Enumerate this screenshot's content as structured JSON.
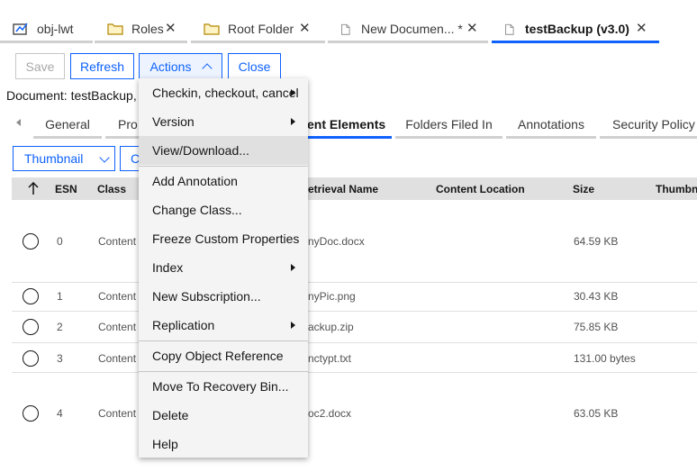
{
  "top_tabs": [
    {
      "label": "obj-lwt",
      "icon": "object-icon",
      "closable": false
    },
    {
      "label": "Roles",
      "icon": "folder-icon",
      "closable": true
    },
    {
      "label": "Root Folder",
      "icon": "folder-icon",
      "closable": true
    },
    {
      "label": "New Documen... *",
      "icon": "document-icon",
      "closable": true
    },
    {
      "label": "testBackup (v3.0)",
      "icon": "document-icon",
      "closable": true,
      "active": true
    }
  ],
  "close_glyph": "✕",
  "toolbar": {
    "save": "Save",
    "refresh": "Refresh",
    "actions": "Actions",
    "close": "Close"
  },
  "document_line": "Document: testBackup, V",
  "sub_tabs": [
    "General",
    "Pro",
    "ent Elements",
    "Folders Filed In",
    "Annotations",
    "Security Policy"
  ],
  "view_select": "Thumbnail",
  "second_button": "C",
  "grid": {
    "headers": [
      "ESN",
      "Class",
      "etrieval Name",
      "Content Location",
      "Size",
      "Thumbn"
    ],
    "rows": [
      {
        "esn": "0",
        "class": "Content",
        "name": "nyDoc.docx",
        "size": "64.59 KB"
      },
      {
        "esn": "1",
        "class": "Content",
        "name": "nyPic.png",
        "size": "30.43 KB"
      },
      {
        "esn": "2",
        "class": "Content",
        "name": "ackup.zip",
        "size": "75.85 KB"
      },
      {
        "esn": "3",
        "class": "Content",
        "name": "nctypt.txt",
        "size": "131.00 bytes"
      },
      {
        "esn": "4",
        "class": "Content",
        "name": "oc2.docx",
        "size": "63.05 KB"
      }
    ]
  },
  "actions_menu": [
    {
      "label": "Checkin, checkout, cancel",
      "submenu": true
    },
    {
      "label": "Version",
      "submenu": true
    },
    {
      "label": "View/Download...",
      "submenu": false,
      "highlighted": true
    },
    {
      "label": "Add Annotation",
      "submenu": false
    },
    {
      "label": "Change Class...",
      "submenu": false
    },
    {
      "label": "Freeze Custom Properties",
      "submenu": false
    },
    {
      "label": "Index",
      "submenu": true
    },
    {
      "label": "New Subscription...",
      "submenu": false
    },
    {
      "label": "Replication",
      "submenu": true
    },
    {
      "label": "Copy Object Reference",
      "submenu": false
    },
    {
      "label": "Move To Recovery Bin...",
      "submenu": false
    },
    {
      "label": "Delete",
      "submenu": false
    },
    {
      "label": "Help",
      "submenu": false
    }
  ],
  "colors": {
    "accent": "#0f62fe",
    "menu_bg": "#f4f4f4",
    "header_bg": "#e0e0e0"
  }
}
